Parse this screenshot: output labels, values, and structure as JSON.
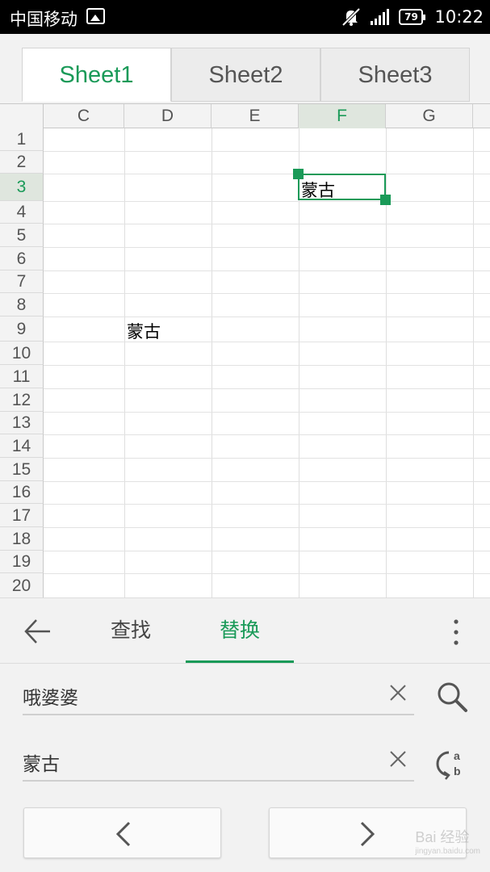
{
  "status_bar": {
    "carrier": "中国移动",
    "battery": "79",
    "time": "10:22"
  },
  "sheet_tabs": [
    "Sheet1",
    "Sheet2",
    "Sheet3"
  ],
  "active_sheet": "Sheet1",
  "grid": {
    "columns": [
      "C",
      "D",
      "E",
      "F",
      "G"
    ],
    "selected_column": "F",
    "rows": [
      "1",
      "2",
      "3",
      "4",
      "5",
      "6",
      "7",
      "8",
      "9",
      "10",
      "11",
      "12",
      "13",
      "14",
      "15",
      "16",
      "17",
      "18",
      "19",
      "20"
    ],
    "selected_row": "3",
    "cells": {
      "F3": "蒙古",
      "D9": "蒙古"
    }
  },
  "find_replace": {
    "tab_find": "查找",
    "tab_replace": "替换",
    "active_tab": "替换",
    "find_value": "哦婆婆",
    "replace_value": "蒙古"
  },
  "watermark": {
    "text": "Bai 经验",
    "sub": "jingyan.baidu.com"
  },
  "colors": {
    "accent": "#1a9a58",
    "status_bar": "#000000"
  }
}
